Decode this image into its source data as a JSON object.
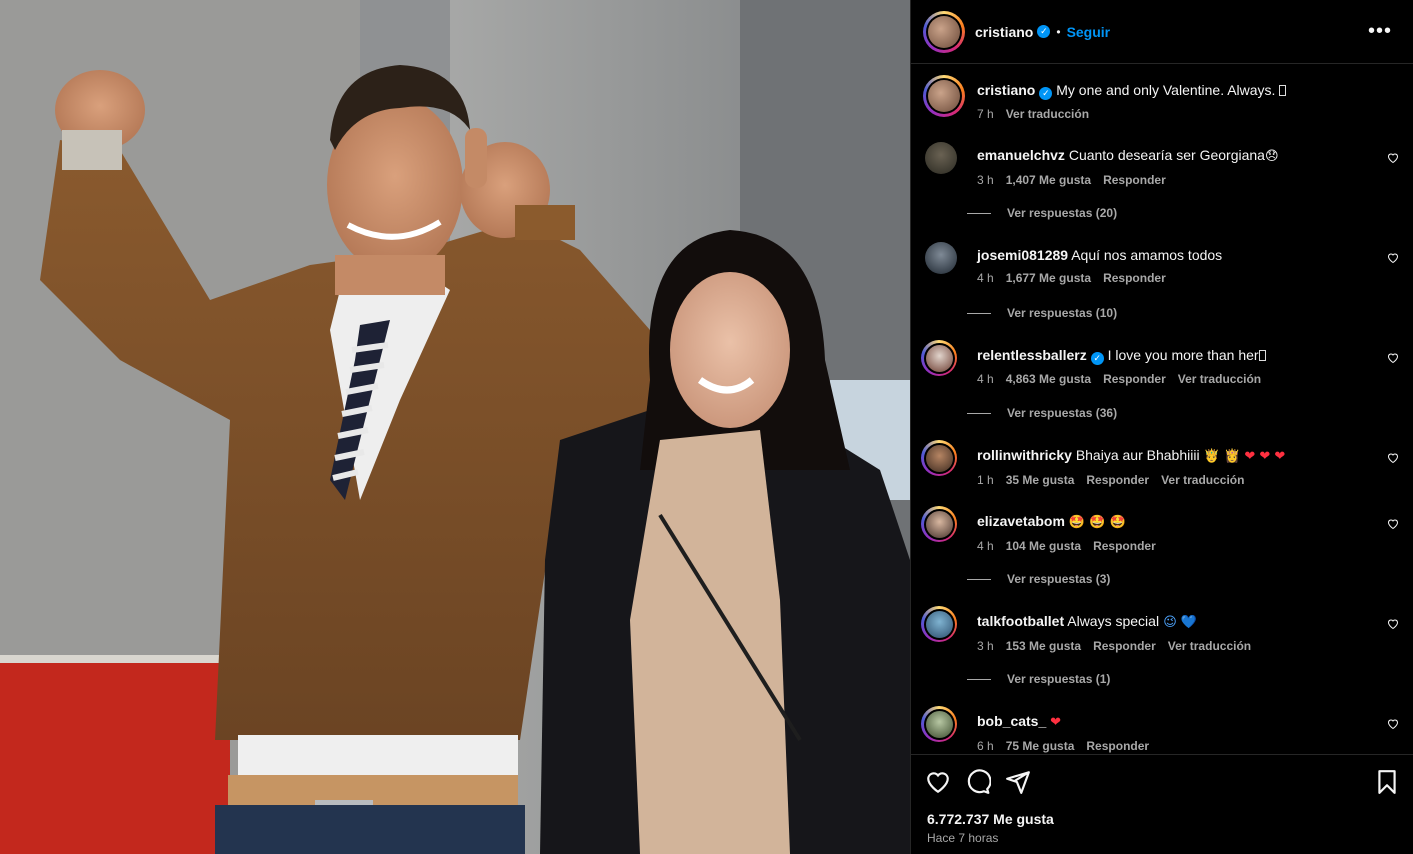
{
  "post": {
    "username": "cristiano",
    "follow_label": "Seguir",
    "more_label": "•••",
    "caption": "My one and only Valentine. Always. ",
    "caption_time": "7 h",
    "caption_translate": "Ver traducción",
    "likes": "6.772.737 Me gusta",
    "posted": "Hace 7 horas"
  },
  "comments": [
    {
      "user": "emanuelchvz",
      "text": "Cuanto desearía ser Georgiana",
      "emoji": "😞",
      "time": "3 h",
      "likes": "1,407 Me gusta",
      "reply": "Responder",
      "replies": "Ver respuestas (20)"
    },
    {
      "user": "josemi081289",
      "text": "Aquí nos amamos todos",
      "emoji": "",
      "time": "4 h",
      "likes": "1,677 Me gusta",
      "reply": "Responder",
      "replies": "Ver respuestas (10)"
    },
    {
      "user": "relentlessballerz",
      "text": "I love you more than her",
      "emoji": "",
      "time": "4 h",
      "likes": "4,863 Me gusta",
      "reply": "Responder",
      "translate": "Ver traducción",
      "replies": "Ver respuestas (36)"
    },
    {
      "user": "rollinwithricky",
      "text": "Bhaiya aur Bhabhiiii",
      "emoji": " 🤴 👸 ❤ ❤ ❤",
      "time": "1 h",
      "likes": "35 Me gusta",
      "reply": "Responder",
      "translate": "Ver traducción"
    },
    {
      "user": "elizavetabom",
      "text": "",
      "emoji": "🤩 🤩 🤩",
      "time": "4 h",
      "likes": "104 Me gusta",
      "reply": "Responder",
      "replies": "Ver respuestas (3)"
    },
    {
      "user": "talkfootballet",
      "text": "Always special",
      "emoji": " 😉 💙",
      "time": "3 h",
      "likes": "153 Me gusta",
      "reply": "Responder",
      "translate": "Ver traducción",
      "replies": "Ver respuestas (1)"
    },
    {
      "user": "bob_cats_",
      "text": "",
      "emoji": "❤",
      "time": "6 h",
      "likes": "75 Me gusta",
      "reply": "Responder"
    }
  ],
  "colors": {
    "accent": "#0095f6",
    "secondary_text": "#a8a8a8",
    "heart_red": "#ff3040"
  },
  "icons": {
    "like": "heart-icon",
    "comment": "comment-icon",
    "share": "share-icon",
    "save": "bookmark-icon",
    "options": "more-options-icon"
  }
}
